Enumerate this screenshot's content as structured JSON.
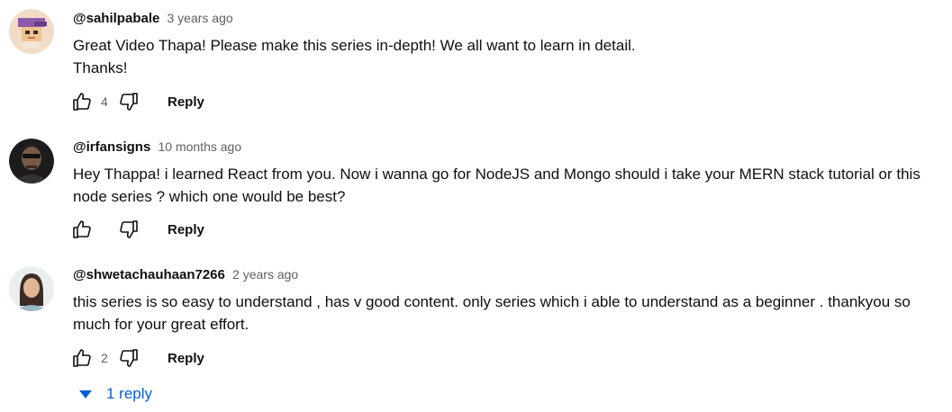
{
  "comments": [
    {
      "author": "@sahilpabale",
      "time": "3 years ago",
      "text_lines": [
        "Great Video Thapa! Please make this series in-depth! We all want to learn in detail.",
        "Thanks!"
      ],
      "likes": "4",
      "reply_label": "Reply"
    },
    {
      "author": "@irfansigns",
      "time": "10 months ago",
      "text_lines": [
        "Hey Thappa! i learned React from you. Now i wanna go for NodeJS and Mongo should i take your MERN stack tutorial or this",
        "node series ? which one would be best?"
      ],
      "likes": "",
      "reply_label": "Reply"
    },
    {
      "author": "@shwetachauhaan7266",
      "time": "2 years ago",
      "text_lines": [
        "this series is so easy to understand , has v good content. only series which i able to understand as a beginner . thankyou so",
        "much for your great effort."
      ],
      "likes": "2",
      "reply_label": "Reply",
      "replies_toggle": "1 reply"
    }
  ],
  "colors": {
    "link_blue": "#065fd4",
    "secondary_text": "#606060"
  },
  "icons": {
    "like": "thumb-up-icon",
    "dislike": "thumb-down-icon",
    "expand": "caret-down-icon"
  }
}
